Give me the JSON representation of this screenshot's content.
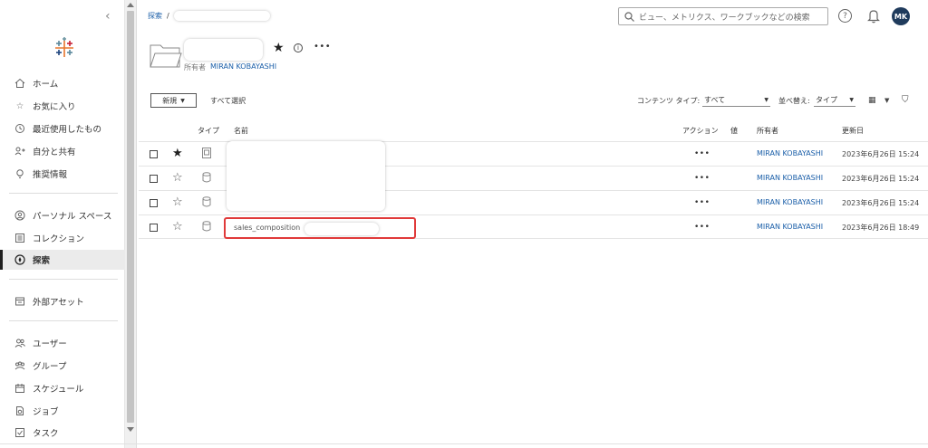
{
  "sidebar": {
    "items": [
      {
        "label": "ホーム",
        "icon": "home-icon"
      },
      {
        "label": "お気に入り",
        "icon": "star-icon"
      },
      {
        "label": "最近使用したもの",
        "icon": "history-icon"
      },
      {
        "label": "自分と共有",
        "icon": "shared-icon"
      },
      {
        "label": "推奨情報",
        "icon": "lightbulb-icon"
      },
      {
        "label": "パーソナル スペース",
        "icon": "personal-space-icon"
      },
      {
        "label": "コレクション",
        "icon": "collection-icon"
      },
      {
        "label": "探索",
        "icon": "explore-icon"
      },
      {
        "label": "外部アセット",
        "icon": "external-assets-icon"
      },
      {
        "label": "ユーザー",
        "icon": "users-icon"
      },
      {
        "label": "グループ",
        "icon": "groups-icon"
      },
      {
        "label": "スケジュール",
        "icon": "schedule-icon"
      },
      {
        "label": "ジョブ",
        "icon": "jobs-icon"
      },
      {
        "label": "タスク",
        "icon": "tasks-icon"
      }
    ],
    "active_item": "探索"
  },
  "header": {
    "breadcrumb_root": "探索",
    "breadcrumb_sep": "/",
    "search_placeholder": "ビュー、メトリクス、ワークブックなどの検索",
    "avatar_initials": "MK"
  },
  "project": {
    "owner_label": "所有者",
    "owner_name": "MIRAN KOBAYASHI",
    "more": "•••"
  },
  "toolbar": {
    "new_label": "新規",
    "select_all": "すべて選択",
    "content_type_label": "コンテンツ タイプ:",
    "content_type_value": "すべて",
    "sort_label": "並べ替え:",
    "sort_value": "タイプ"
  },
  "table": {
    "headers": {
      "type": "タイプ",
      "name": "名前",
      "actions": "アクション",
      "value": "値",
      "owner": "所有者",
      "updated": "更新日"
    },
    "rows": [
      {
        "favorite": true,
        "type_icon": "workbook-icon",
        "name": "",
        "actions": "•••",
        "owner": "MIRAN KOBAYASHI",
        "updated": "2023年6月26日 15:24"
      },
      {
        "favorite": false,
        "type_icon": "datasource-icon",
        "name": "",
        "actions": "•••",
        "owner": "MIRAN KOBAYASHI",
        "updated": "2023年6月26日 15:24"
      },
      {
        "favorite": false,
        "type_icon": "datasource-icon",
        "name": "",
        "actions": "•••",
        "owner": "MIRAN KOBAYASHI",
        "updated": "2023年6月26日 15:24"
      },
      {
        "favorite": false,
        "type_icon": "datasource-icon",
        "name": "sales_composition",
        "actions": "•••",
        "owner": "MIRAN KOBAYASHI",
        "updated": "2023年6月26日 18:49"
      }
    ]
  },
  "colors": {
    "accent_link": "#1a5ea8",
    "highlight": "#e03a3a",
    "avatar_bg": "#1f3b5c"
  }
}
